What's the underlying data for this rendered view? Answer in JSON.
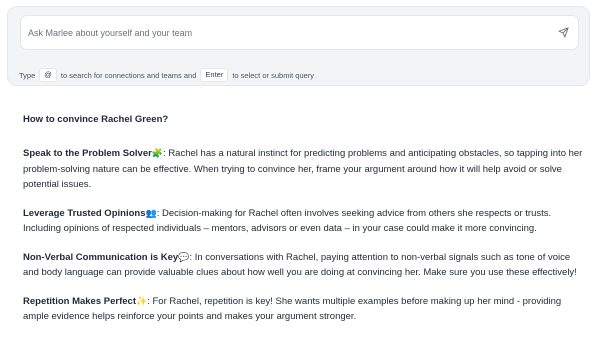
{
  "query": {
    "placeholder": "Ask Marlee about yourself and your team",
    "value": "",
    "send_icon": "send-icon"
  },
  "hint": {
    "type_label": "Type",
    "at_key": "@",
    "at_text": "to search for connections and teams and",
    "enter_key": "Enter",
    "enter_text": "to select or submit query"
  },
  "answer": {
    "title": "How to convince Rachel Green?",
    "tips": [
      {
        "title": "Speak to the Problem Solver",
        "emoji": "🧩",
        "text": ": Rachel has a natural instinct for predicting problems and anticipating obstacles, so tapping into her problem-solving nature can be effective. When trying to convince her, frame your argument around how it will help avoid or solve potential issues."
      },
      {
        "title": "Leverage Trusted Opinions",
        "emoji": "👥",
        "text": ": Decision-making for Rachel often involves seeking advice from others she respects or trusts. Including opinions of respected individuals – mentors, advisors or even data – in your case could make it more convincing."
      },
      {
        "title": "Non-Verbal Communication is Key",
        "emoji": "💬",
        "text": ": In conversations with Rachel, paying attention to non-verbal signals such as tone of voice and body language can provide valuable clues about how well you are doing at convincing her. Make sure you use these effectively!"
      },
      {
        "title": "Repetition Makes Perfect",
        "emoji": "✨",
        "text": ": For Rachel, repetition is key! She wants multiple examples before making up her mind - providing ample evidence helps reinforce your points and makes your argument stronger."
      }
    ]
  }
}
